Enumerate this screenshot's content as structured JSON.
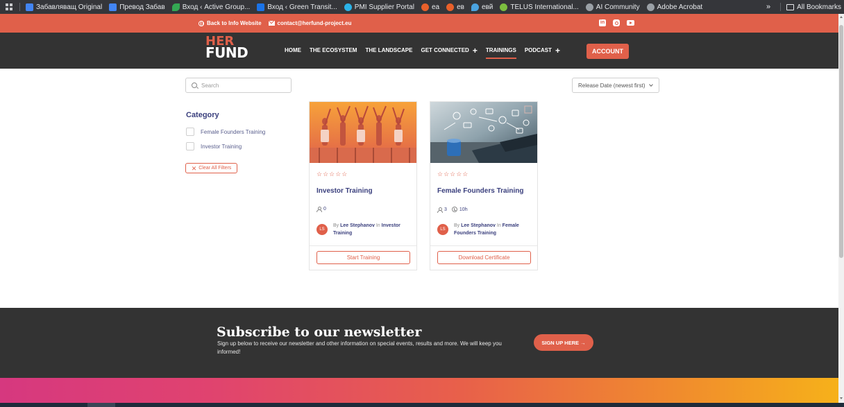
{
  "bookmarks": {
    "items": [
      {
        "label": "Забавляващ Original",
        "icon": "doc-icon",
        "color": "#4285f4"
      },
      {
        "label": "Превод Забав",
        "icon": "doc-icon",
        "color": "#4285f4"
      },
      {
        "label": "Вход ‹ Active Group...",
        "icon": "leaf-icon",
        "color": "#34a853"
      },
      {
        "label": "Вход ‹ Green Transit...",
        "icon": "site-icon",
        "color": "#1a73e8"
      },
      {
        "label": "PMI Supplier Portal",
        "icon": "react-icon",
        "color": "#2bb3e8"
      },
      {
        "label": "еа",
        "icon": "cc-icon",
        "color": "#e8602a"
      },
      {
        "label": "ев",
        "icon": "cc-icon",
        "color": "#e8602a"
      },
      {
        "label": "евй",
        "icon": "drop-icon",
        "color": "#4aa3e0"
      },
      {
        "label": "TELUS International...",
        "icon": "telus-icon",
        "color": "#7cbf3f"
      },
      {
        "label": "AI Community",
        "icon": "globe-icon",
        "color": "#9aa0a6"
      },
      {
        "label": "Adobe Acrobat",
        "icon": "globe-icon",
        "color": "#9aa0a6"
      }
    ],
    "more": "»",
    "all_bookmarks": "All Bookmarks"
  },
  "topbar": {
    "back_link": "Back to Info Website",
    "email": "contact@herfund-project.eu",
    "social": [
      "linkedin-icon",
      "instagram-icon",
      "youtube-icon"
    ]
  },
  "header": {
    "logo_top": "HER",
    "logo_bottom": "FUND",
    "nav": [
      {
        "label": "HOME",
        "plus": ""
      },
      {
        "label": "THE ECOSYSTEM",
        "plus": ""
      },
      {
        "label": "THE LANDSCAPE",
        "plus": ""
      },
      {
        "label": "GET CONNECTED",
        "plus": "+"
      },
      {
        "label": "TRAININGS",
        "plus": ""
      },
      {
        "label": "PODCAST",
        "plus": "+"
      }
    ],
    "active_nav": "TRAININGS",
    "account": "ACCOUNT"
  },
  "filters": {
    "search_placeholder": "Search",
    "sort_value": "Release Date (newest first)",
    "category_title": "Category",
    "categories": [
      "Female Founders Training",
      "Investor Training"
    ],
    "clear_label": "Clear All Filters"
  },
  "courses": [
    {
      "stars": "☆☆☆☆☆",
      "title": "Investor Training",
      "students": "0",
      "duration": "",
      "avatar": "LS",
      "by": "By",
      "author": "Lee Stephanov",
      "in": "In",
      "category": "Investor Training",
      "button": "Start Training"
    },
    {
      "stars": "☆☆☆☆☆",
      "title": "Female Founders Training",
      "students": "3",
      "duration": "10h",
      "avatar": "LS",
      "by": "By",
      "author": "Lee Stephanov",
      "in": "In",
      "category": "Female Founders Training",
      "button": "Download Certificate"
    }
  ],
  "newsletter": {
    "title": "Subscribe to our newsletter",
    "text": "Sign up below to receive our newsletter and other information on special events, results and more. We will keep you informed!",
    "button": "SIGN UP HERE →"
  },
  "colors": {
    "accent": "#e0604a",
    "dark": "#333333",
    "heading": "#3a3f7d"
  }
}
